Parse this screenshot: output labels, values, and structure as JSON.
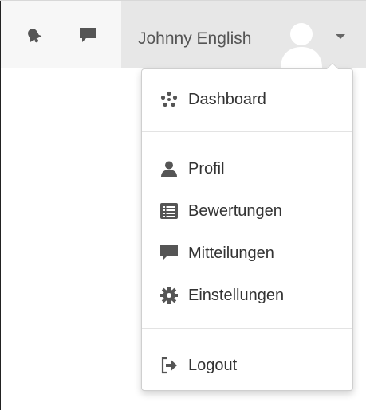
{
  "navbar": {
    "notifications_icon": "bell-icon",
    "messages_icon": "comment-icon",
    "user": {
      "name": "Johnny English",
      "avatar_icon": "user-silhouette-icon",
      "toggle_icon": "caret-down-icon"
    }
  },
  "menu": {
    "sections": [
      {
        "items": [
          {
            "label": "Dashboard",
            "icon": "dashboard-icon"
          }
        ]
      },
      {
        "items": [
          {
            "label": "Profil",
            "icon": "user-icon"
          },
          {
            "label": "Bewertungen",
            "icon": "list-icon"
          },
          {
            "label": "Mitteilungen",
            "icon": "comment-icon"
          },
          {
            "label": "Einstellungen",
            "icon": "gear-icon"
          }
        ]
      },
      {
        "items": [
          {
            "label": "Logout",
            "icon": "logout-icon"
          }
        ]
      }
    ]
  },
  "colors": {
    "navbar_background": "#f7f7f7",
    "user_toggle_background": "#e7e7e7",
    "icon_gray": "#555555",
    "text": "#333333",
    "border": "#cfcfcf"
  }
}
